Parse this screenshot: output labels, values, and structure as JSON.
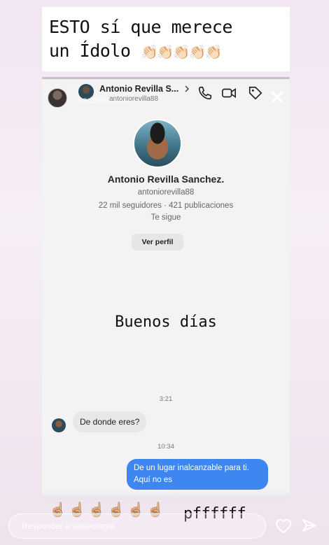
{
  "caption": {
    "line1": "ESTO sí que merece",
    "line2": "un Ídolo",
    "emoji": "👏🏻👏🏻👏🏻👏🏻👏🏻"
  },
  "shared_post": {
    "poster_name": "madamecrepe",
    "header": {
      "name": "Antonio Revilla S...",
      "username": "antoniorevilla88",
      "icons": [
        "chevron-right-icon",
        "phone-icon",
        "video-icon",
        "tag-icon"
      ]
    },
    "profile": {
      "name": "Antonio Revilla Sanchez.",
      "handle": "antoniorevilla88",
      "stats": "22 mil seguidores · 421 publicaciones",
      "follows": "Te sigue",
      "view_button": "Ver perfil"
    },
    "overlay_text": "Buenos días",
    "messages": [
      {
        "time": "3:21"
      },
      {
        "from": "them",
        "text": "De donde eres?"
      },
      {
        "time": "10:34"
      },
      {
        "from": "me",
        "text": "De un lugar inalcanzable para ti. Aquí no es"
      }
    ]
  },
  "bottom_overlay": {
    "fingers": "☝🏼☝🏼☝🏼☝🏼☝🏼☝🏼",
    "text": "pffffff"
  },
  "reply_bar": {
    "placeholder": "Responder a salseologia..."
  },
  "colors": {
    "bubble_out": "#3e86f0",
    "bubble_in": "#e8e8ea",
    "background": "#f1e6f2"
  }
}
